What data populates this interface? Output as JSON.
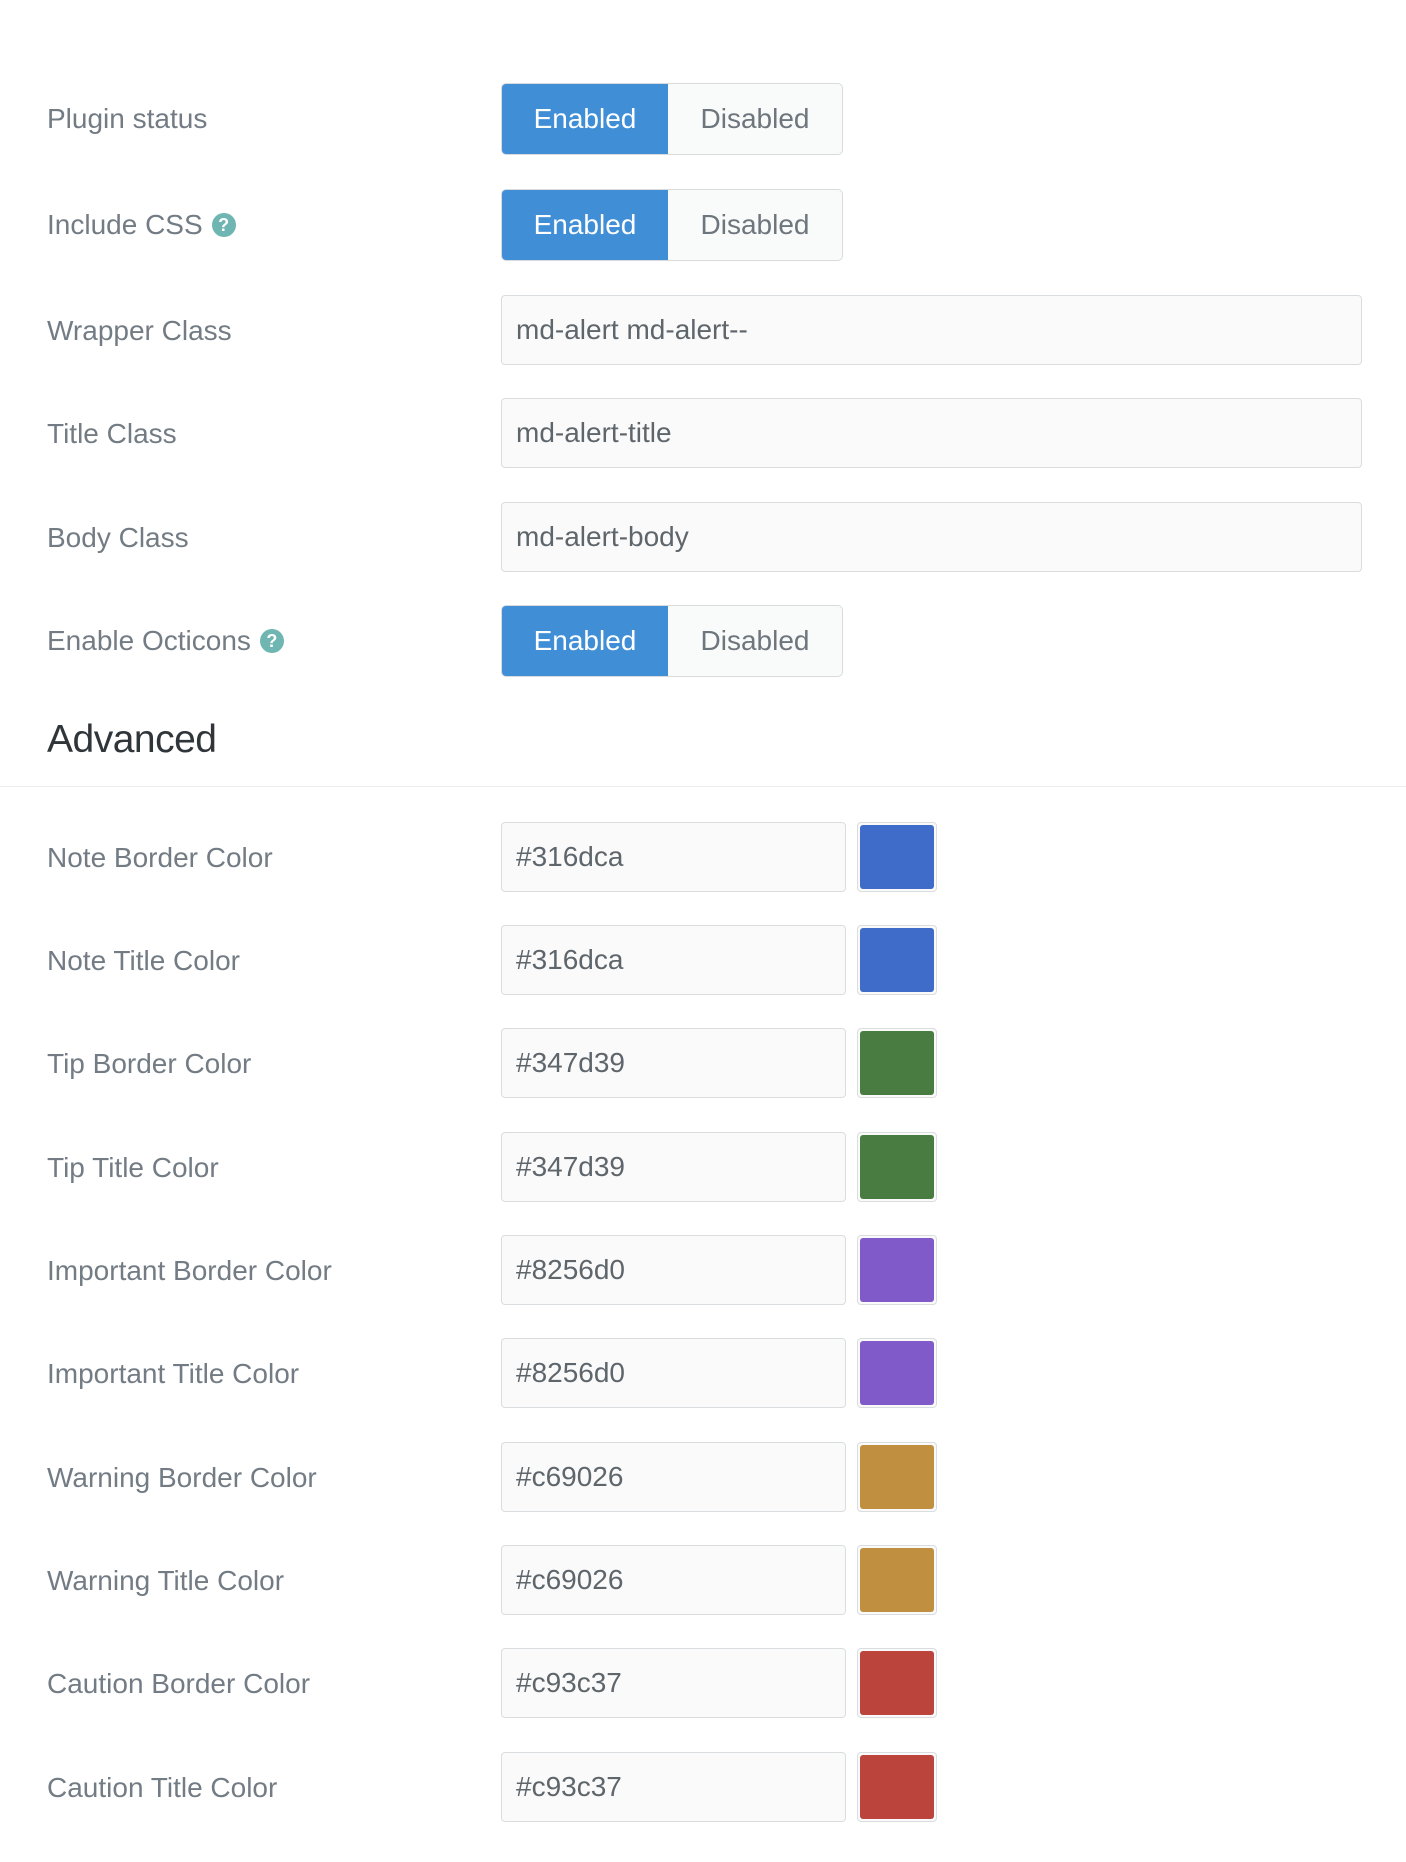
{
  "general": {
    "plugin_status": {
      "label": "Plugin status",
      "on": "Enabled",
      "off": "Disabled",
      "selected": "Enabled"
    },
    "include_css": {
      "label": "Include CSS",
      "help": "?",
      "on": "Enabled",
      "off": "Disabled",
      "selected": "Enabled"
    },
    "wrapper_class": {
      "label": "Wrapper Class",
      "value": "md-alert md-alert--"
    },
    "title_class": {
      "label": "Title Class",
      "value": "md-alert-title"
    },
    "body_class": {
      "label": "Body Class",
      "value": "md-alert-body"
    },
    "enable_octicons": {
      "label": "Enable Octicons",
      "help": "?",
      "on": "Enabled",
      "off": "Disabled",
      "selected": "Enabled"
    }
  },
  "advanced": {
    "title": "Advanced",
    "colors": [
      {
        "label": "Note Border Color",
        "value": "#316dca",
        "swatch": "#3f6cc8"
      },
      {
        "label": "Note Title Color",
        "value": "#316dca",
        "swatch": "#3f6cc8"
      },
      {
        "label": "Tip Border Color",
        "value": "#347d39",
        "swatch": "#497c41"
      },
      {
        "label": "Tip Title Color",
        "value": "#347d39",
        "swatch": "#497c41"
      },
      {
        "label": "Important Border Color",
        "value": "#8256d0",
        "swatch": "#7f5ac8"
      },
      {
        "label": "Important Title Color",
        "value": "#8256d0",
        "swatch": "#7f5ac8"
      },
      {
        "label": "Warning Border Color",
        "value": "#c69026",
        "swatch": "#c08f3f"
      },
      {
        "label": "Warning Title Color",
        "value": "#c69026",
        "swatch": "#c08f3f"
      },
      {
        "label": "Caution Border Color",
        "value": "#c93c37",
        "swatch": "#bb453d"
      },
      {
        "label": "Caution Title Color",
        "value": "#c93c37",
        "swatch": "#bb453d"
      }
    ]
  },
  "colors": {
    "accent": "#408fd6",
    "help_icon": "#6fb6b3",
    "label": "#737c84"
  }
}
